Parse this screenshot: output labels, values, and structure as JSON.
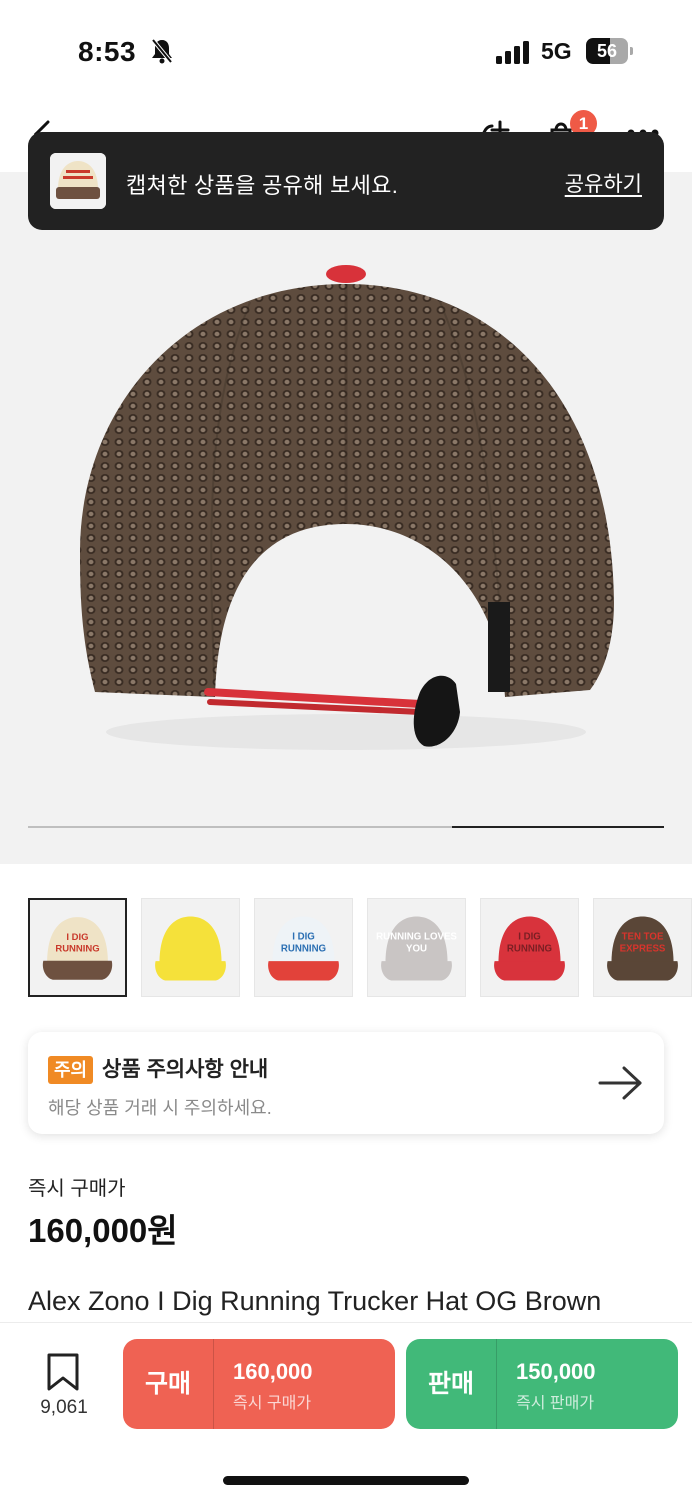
{
  "status_bar": {
    "time": "8:53",
    "network": "5G",
    "battery_level": "56",
    "battery_fraction": 0.56
  },
  "nav": {
    "cart_badge": "1",
    "icons": [
      "back-arrow-icon",
      "share-plus-icon",
      "shopping-bag-icon",
      "more-icon"
    ]
  },
  "toast": {
    "message": "캡쳐한 상품을 공유해 보세요.",
    "action": "공유하기"
  },
  "hero": {
    "image": "brown mesh trucker cap, back view with red strap",
    "carousel_progress_start": 0.667,
    "carousel_progress_end": 1.0
  },
  "thumbnails": [
    {
      "name": "I DIG RUNNING cream/brown cap",
      "text": "I DIG RUNNING",
      "crown": "#efe3c6",
      "brim": "#6e5140",
      "ink": "#c93a2c",
      "selected": true
    },
    {
      "name": "yellow running cap",
      "text": "",
      "crown": "#f5e13a",
      "brim": "#f5e13a",
      "ink": "#c93a2c",
      "selected": false
    },
    {
      "name": "I DIG RUNNING white/red cap",
      "text": "I DIG RUNNING",
      "crown": "#eef3f7",
      "brim": "#e2423a",
      "ink": "#2b6fb3",
      "selected": false
    },
    {
      "name": "RUNNING LOVES YOU grey cap",
      "text": "RUNNING LOVES YOU",
      "crown": "#c9c5c4",
      "brim": "#c9c5c4",
      "ink": "#ffffff",
      "selected": false
    },
    {
      "name": "I DIG RUNNING red cap",
      "text": "I DIG RUNNING",
      "crown": "#d8333c",
      "brim": "#d8333c",
      "ink": "#7a1f24",
      "selected": false
    },
    {
      "name": "TEN TOE EXPRESS brown cap",
      "text": "TEN TOE EXPRESS",
      "crown": "#5a4637",
      "brim": "#5a4637",
      "ink": "#d8342c",
      "selected": false
    }
  ],
  "notice": {
    "badge": "주의",
    "title": "상품 주의사항 안내",
    "subtitle": "해당 상품 거래 시 주의하세요."
  },
  "price": {
    "label": "즉시 구매가",
    "value": "160,000원"
  },
  "product": {
    "name": "Alex Zono I Dig Running Trucker Hat OG Brown"
  },
  "bottom_bar": {
    "wish_count": "9,061",
    "buy": {
      "label": "구매",
      "price": "160,000",
      "sub": "즉시 구매가"
    },
    "sell": {
      "label": "판매",
      "price": "150,000",
      "sub": "즉시 판매가"
    }
  },
  "colors": {
    "buy": "#ef6253",
    "sell": "#41b979",
    "notice_badge": "#f08a24",
    "toast_bg": "#222222",
    "badge": "#ef5a46"
  }
}
